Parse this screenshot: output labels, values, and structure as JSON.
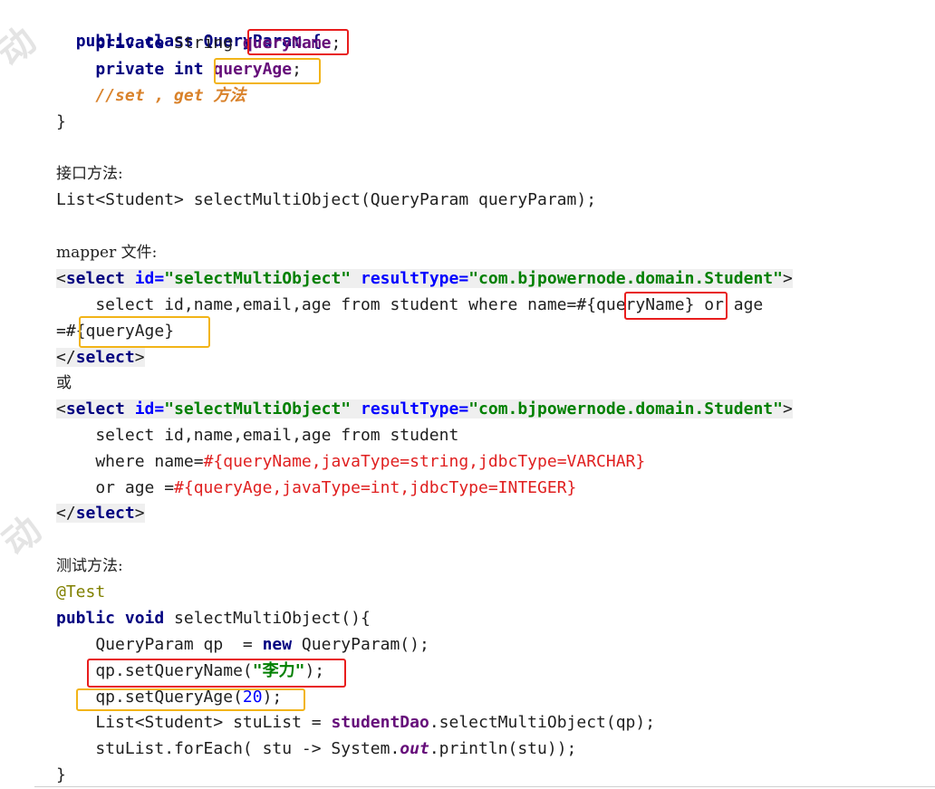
{
  "code": {
    "class_decl": "public class QueryParam {",
    "field1_kw": "private",
    "field1_type": " String ",
    "field1_name": "queryName",
    "field1_end": ";",
    "field2_kw": "private int ",
    "field2_name": "queryAge",
    "field2_end": ";",
    "comment": "//set , get 方法",
    "close1": "}",
    "interface_label": "接口方法:",
    "interface_sig": "List<Student> selectMultiObject(QueryParam queryParam);",
    "mapper_label": "mapper 文件:",
    "sel1_open_a": "<",
    "sel1_open_kw": "select",
    "sel1_id_attr": " id=",
    "sel1_id_val": "\"selectMultiObject\"",
    "sel1_rt_attr": " resultType=",
    "sel1_rt_val": "\"com.bjpowernode.domain.Student\"",
    "sel1_open_z": ">",
    "sel1_body_a": "    select id,name,email,age from student where name=#{",
    "sel1_body_b": "queryName",
    "sel1_body_c": "} or age",
    "sel1_body2": "=#{queryAge}",
    "sel1_close_a": "</",
    "sel1_close_kw": "select",
    "sel1_close_z": ">",
    "or_label": "或",
    "sel2_body1": "    select id,name,email,age from student",
    "sel2_where_a": "    where name=",
    "sel2_where_b": "#{queryName,javaType=string,jdbcType=VARCHAR}",
    "sel2_or_a": "    or age =",
    "sel2_or_b": "#{queryAge,javaType=int,jdbcType=INTEGER}",
    "test_label": "测试方法:",
    "test_ann": "@Test",
    "test_sig_kw": "public void",
    "test_sig": " selectMultiObject(){",
    "t1_a": "    QueryParam qp  = ",
    "t1_kw": "new",
    "t1_b": " QueryParam();",
    "t2_a": "    qp.setQueryName(",
    "t2_str": "\"李力\"",
    "t2_b": ");",
    "t3_a": "    qp.setQueryAge(",
    "t3_num": "20",
    "t3_b": ");",
    "t4_a": "    List<Student> stuList = ",
    "t4_bold": "studentDao",
    "t4_b": ".selectMultiObject(qp);",
    "t5_a": "    stuList.forEach( stu -> System.",
    "t5_ital": "out",
    "t5_b": ".println(stu));",
    "close2": "}"
  },
  "colors": {
    "keyword": "#000080",
    "field": "#660e7a",
    "comment": "#d9822b",
    "xml_value": "#008000",
    "xml_attr": "#0000ff",
    "param_red": "#e02020",
    "box_red": "#e81d1d",
    "box_yellow": "#f2b418"
  }
}
